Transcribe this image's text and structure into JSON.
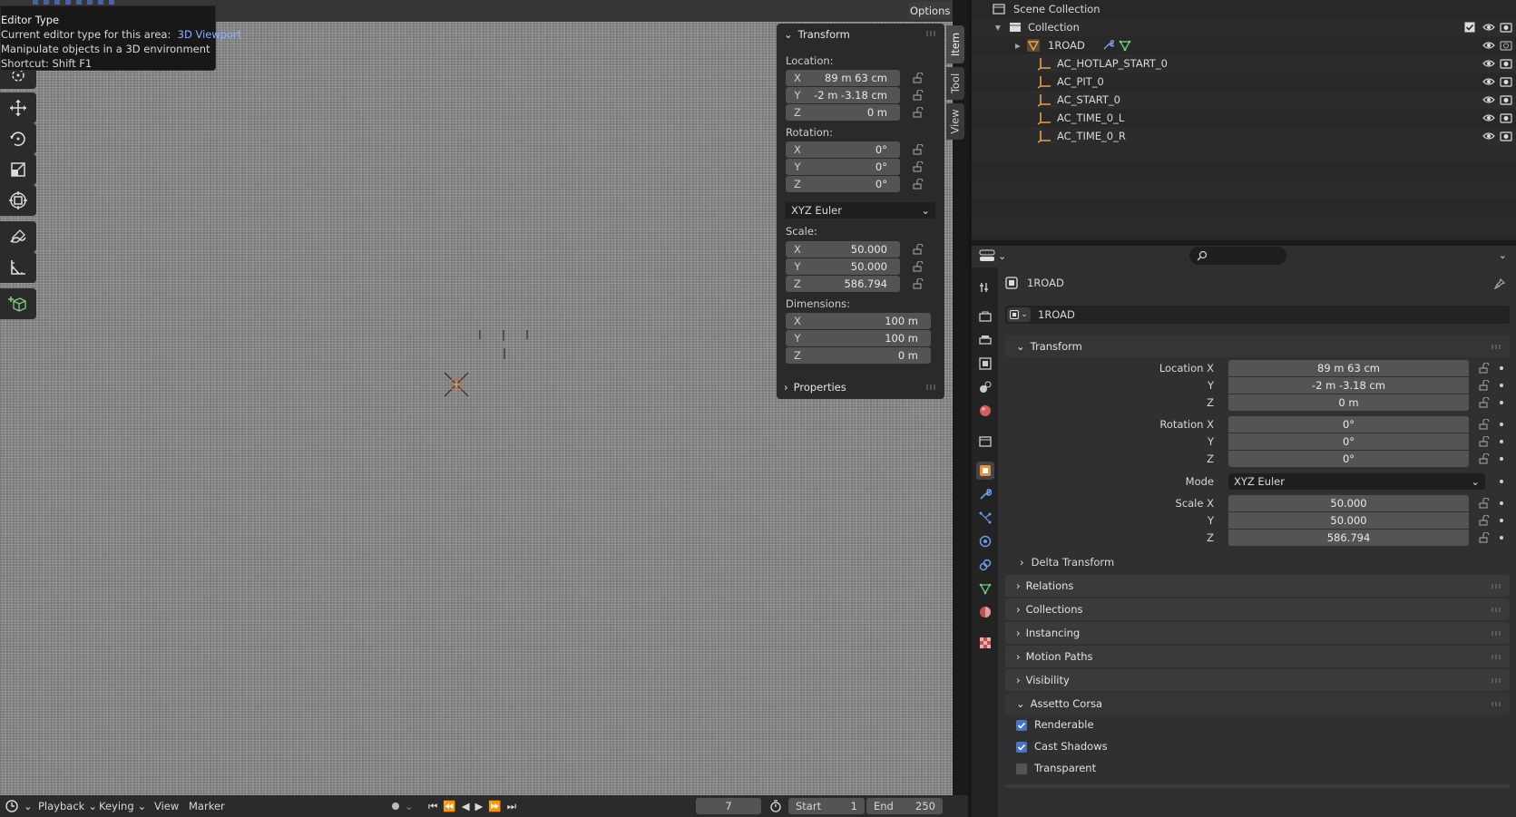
{
  "viewport": {
    "header": {
      "options_label": "Options"
    },
    "tooltip": {
      "title": "Editor Type",
      "line1_prefix": "Current editor type for this area:",
      "line1_value": "3D Viewport",
      "line2": "Manipulate objects in a 3D environment",
      "line3": "Shortcut: Shift F1"
    },
    "tools": [
      "cursor-tool",
      "move-tool",
      "rotate-tool",
      "scale-tool",
      "transform-tool",
      "annotate-tool",
      "measure-tool",
      "add-cube-tool"
    ]
  },
  "npanel": {
    "title": "Transform",
    "location_label": "Location:",
    "location": [
      {
        "axis": "X",
        "value": "89 m 63 cm"
      },
      {
        "axis": "Y",
        "value": "-2 m -3.18 cm"
      },
      {
        "axis": "Z",
        "value": "0 m"
      }
    ],
    "rotation_label": "Rotation:",
    "rotation": [
      {
        "axis": "X",
        "value": "0°"
      },
      {
        "axis": "Y",
        "value": "0°"
      },
      {
        "axis": "Z",
        "value": "0°"
      }
    ],
    "rotation_mode": "XYZ Euler",
    "scale_label": "Scale:",
    "scale": [
      {
        "axis": "X",
        "value": "50.000"
      },
      {
        "axis": "Y",
        "value": "50.000"
      },
      {
        "axis": "Z",
        "value": "586.794"
      }
    ],
    "dimensions_label": "Dimensions:",
    "dimensions": [
      {
        "axis": "X",
        "value": "100 m"
      },
      {
        "axis": "Y",
        "value": "100 m"
      },
      {
        "axis": "Z",
        "value": "0 m"
      }
    ],
    "properties_label": "Properties",
    "tabs": [
      "Item",
      "Tool",
      "View"
    ]
  },
  "timeline": {
    "menus": [
      "Playback",
      "Keying",
      "View",
      "Marker"
    ],
    "current_frame": "7",
    "start_label": "Start",
    "start_value": "1",
    "end_label": "End",
    "end_value": "250"
  },
  "outliner": {
    "scene_collection": "Scene Collection",
    "collection": "Collection",
    "items": [
      "1ROAD",
      "AC_HOTLAP_START_0",
      "AC_PIT_0",
      "AC_START_0",
      "AC_TIME_0_L",
      "AC_TIME_0_R"
    ]
  },
  "properties": {
    "object_name": "1ROAD",
    "datablock_name": "1ROAD",
    "transform": {
      "title": "Transform",
      "location_x_label": "Location X",
      "location": [
        "89 m 63 cm",
        "-2 m -3.18 cm",
        "0 m"
      ],
      "rotation_x_label": "Rotation X",
      "rotation": [
        "0°",
        "0°",
        "0°"
      ],
      "mode_label": "Mode",
      "mode_value": "XYZ Euler",
      "scale_x_label": "Scale X",
      "scale": [
        "50.000",
        "50.000",
        "586.794"
      ],
      "y_label": "Y",
      "z_label": "Z",
      "delta_transform": "Delta Transform"
    },
    "sections": [
      "Relations",
      "Collections",
      "Instancing",
      "Motion Paths",
      "Visibility"
    ],
    "assetto_corsa": {
      "title": "Assetto Corsa",
      "renderable": "Renderable",
      "cast_shadows": "Cast Shadows",
      "transparent": "Transparent"
    }
  }
}
